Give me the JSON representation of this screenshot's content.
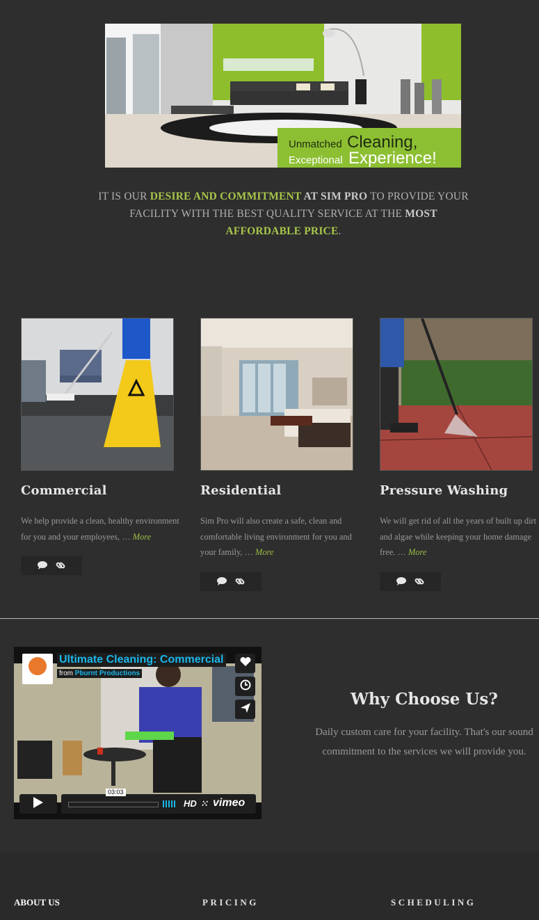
{
  "hero": {
    "line1_small": "Unmatched",
    "line1_big": "Cleaning,",
    "line2_small": "Exceptional",
    "line2_big": "Experience!"
  },
  "tagline": {
    "p1": "It is our ",
    "p2": "desire and commitment",
    "p3": " at Sim Pro",
    "p4": " to provide your facility with the best quality service at the ",
    "p5": "most",
    "p6": "affordable price",
    "p7": "."
  },
  "services": [
    {
      "title": "Commercial",
      "text": "We help provide a clean, healthy environment for you and your employees, … ",
      "more": "More"
    },
    {
      "title": "Residential",
      "text": "Sim Pro will also create a safe, clean and comfortable living environment for you and your family, … ",
      "more": "More"
    },
    {
      "title": "Pressure Washing",
      "text": "We will get rid of all the years of built up dirt and algae while keeping your home damage free. … ",
      "more": "More"
    }
  ],
  "video": {
    "title": "Ultimate Cleaning: Commercial",
    "from": "from",
    "author": "Pburnt Productions",
    "time": "03:03",
    "hd": "HD",
    "brand": "vimeo"
  },
  "why": {
    "heading": "Why Choose Us?",
    "text": "Daily custom care for your facility. That's our sound commitment to the services we will provide you."
  },
  "footer": {
    "col1": "ABOUT US",
    "col2": "PRICING",
    "col3": "SCHEDULING"
  },
  "colors": {
    "background": "#2e2e2e",
    "accent_green": "#a8c64a",
    "vimeo_blue": "#1ab7ea"
  },
  "icons": [
    "comment-icon",
    "link-icon",
    "heart-icon",
    "clock-icon",
    "send-icon",
    "play-icon"
  ]
}
